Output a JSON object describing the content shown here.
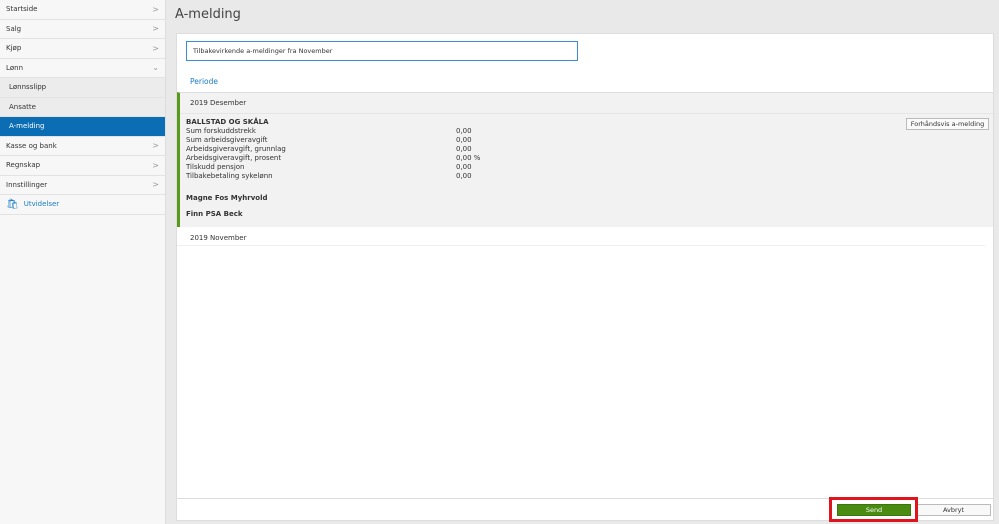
{
  "sidebar": {
    "items": [
      {
        "label": "Startside"
      },
      {
        "label": "Salg"
      },
      {
        "label": "Kjøp"
      },
      {
        "label": "Lønn"
      },
      {
        "label": "Lønnsslipp"
      },
      {
        "label": "Ansatte"
      },
      {
        "label": "A-melding"
      },
      {
        "label": "Kasse og bank"
      },
      {
        "label": "Regnskap"
      },
      {
        "label": "Innstillinger"
      }
    ],
    "extensions": "Utvidelser"
  },
  "header": {
    "title": "A-melding"
  },
  "filter": {
    "value": "Tilbakevirkende a-meldinger fra November"
  },
  "periode_label": "Periode",
  "sections": [
    {
      "title": "2019 Desember",
      "org": "BALLSTAD OG SKÅLA",
      "preview_button": "Forhåndsvis a-melding",
      "rows": [
        {
          "label": "Sum forskuddstrekk",
          "value": "0,00"
        },
        {
          "label": "Sum arbeidsgiveravgift",
          "value": "0,00"
        },
        {
          "label": "Arbeidsgiveravgift, grunnlag",
          "value": "0,00"
        },
        {
          "label": "Arbeidsgiveravgift, prosent",
          "value": "0,00 %"
        },
        {
          "label": "Tilskudd pensjon",
          "value": "0,00"
        },
        {
          "label": "Tilbakebetaling sykelønn",
          "value": "0,00"
        }
      ],
      "employees": [
        "Magne Fos Myhrvold",
        "Finn PSA Beck"
      ]
    },
    {
      "title": "2019 November"
    }
  ],
  "footer": {
    "send": "Send",
    "cancel": "Avbryt"
  }
}
